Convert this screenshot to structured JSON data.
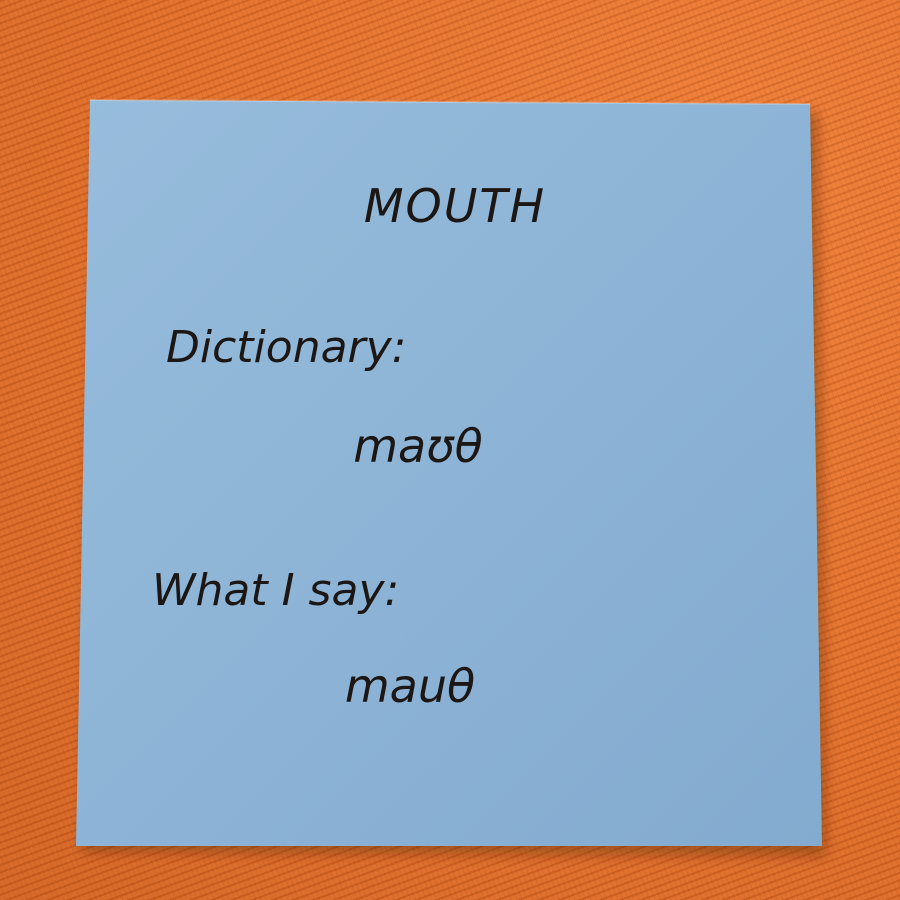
{
  "note": {
    "color": "#8fb5d6",
    "background_color": "#e8772f",
    "title": "MOUTH",
    "label_dictionary": "Dictionary:",
    "value_dictionary": "maʊθ",
    "label_what_i_say": "What I say:",
    "value_what_i_say": "mauθ"
  }
}
